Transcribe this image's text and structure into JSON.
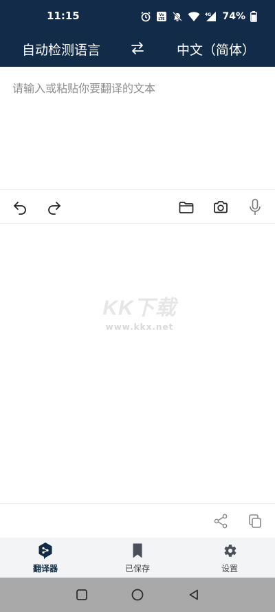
{
  "status_bar": {
    "time": "11:15",
    "battery": "74%",
    "icons": [
      "alarm-icon",
      "volte-icon",
      "mute-icon",
      "wifi-icon",
      "signal-4g-icon",
      "battery-icon"
    ]
  },
  "language_bar": {
    "source": "自动检测语言",
    "target": "中文（简体）",
    "swap_icon": "swap-arrows-icon"
  },
  "input": {
    "placeholder": "请输入或粘贴你要翻译的文本",
    "value": ""
  },
  "toolbar": {
    "left": [
      "undo-icon",
      "redo-icon"
    ],
    "right": [
      "folder-icon",
      "camera-icon",
      "microphone-icon"
    ]
  },
  "output": {
    "watermark_logo": "KK下载",
    "watermark_url": "www.kkx.net"
  },
  "actions": [
    "share-icon",
    "copy-icon"
  ],
  "bottom_nav": {
    "items": [
      {
        "label": "翻译器",
        "icon": "deepl-logo-icon",
        "active": true
      },
      {
        "label": "已保存",
        "icon": "bookmark-icon",
        "active": false
      },
      {
        "label": "设置",
        "icon": "gear-icon",
        "active": false
      }
    ]
  },
  "colors": {
    "header_bg": "#122b49",
    "accent": "#0f2b46",
    "nav_bg": "#f3f4f6",
    "system_nav_bg": "#a9a9a9"
  }
}
